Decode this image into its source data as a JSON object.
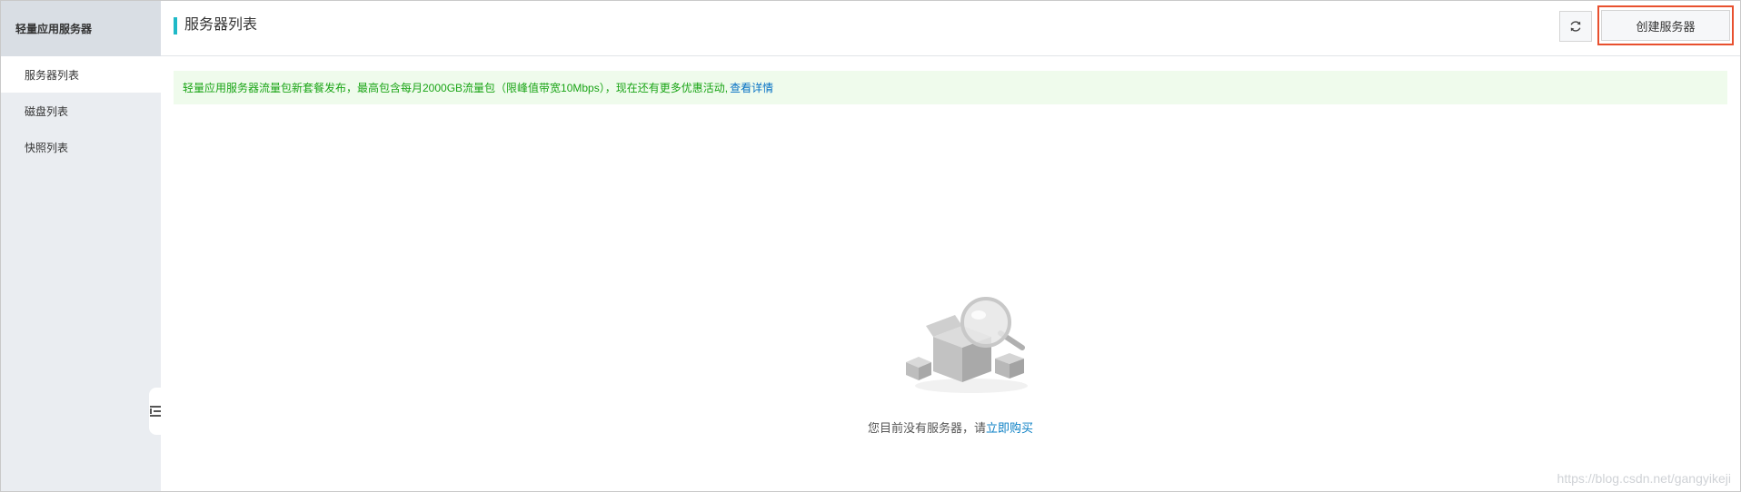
{
  "sidebar": {
    "header": "轻量应用服务器",
    "items": [
      {
        "label": "服务器列表",
        "active": true
      },
      {
        "label": "磁盘列表",
        "active": false
      },
      {
        "label": "快照列表",
        "active": false
      }
    ],
    "collapse_icon": "collapse-list-icon"
  },
  "header": {
    "title": "服务器列表",
    "refresh_icon": "refresh-icon",
    "create_button": "创建服务器"
  },
  "notice": {
    "text": "轻量应用服务器流量包新套餐发布，最高包含每月2000GB流量包（限峰值带宽10Mbps），现在还有更多优惠活动,",
    "link": "查看详情"
  },
  "empty_state": {
    "illustration": "empty-box-magnifier-illustration",
    "text": "您目前没有服务器，请",
    "link": "立即购买"
  },
  "watermark": "https://blog.csdn.net/gangyikeji",
  "colors": {
    "accent": "#1fb9c7",
    "highlight_border": "#e8502e",
    "notice_bg": "#effbec",
    "notice_text": "#19a415",
    "link": "#0570c4"
  }
}
